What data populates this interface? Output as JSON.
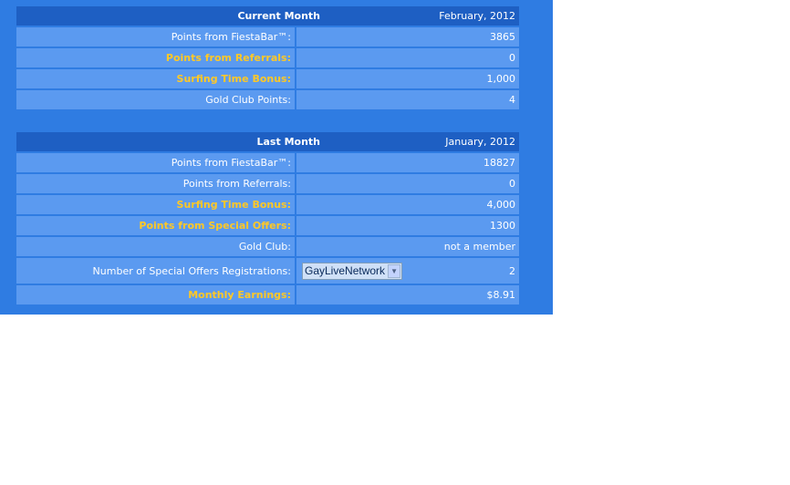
{
  "current_month": {
    "title": "Current Month",
    "date": "February, 2012",
    "rows": [
      {
        "label": "Points from FiestaBar™:",
        "value": "3865"
      },
      {
        "label": "Points from Referrals:",
        "value": "0"
      },
      {
        "label": "Surfing Time Bonus:",
        "value": "1,000"
      },
      {
        "label": "Gold Club Points:",
        "value": "4"
      }
    ]
  },
  "last_month": {
    "title": "Last Month",
    "date": "January, 2012",
    "rows": [
      {
        "label": "Points from FiestaBar™:",
        "value": "18827"
      },
      {
        "label": "Points from Referrals:",
        "value": "0"
      },
      {
        "label": "Surfing Time Bonus:",
        "value": "4,000"
      },
      {
        "label": "Points from Special Offers:",
        "value": "1300"
      },
      {
        "label": "Gold Club:",
        "value": "not a member"
      },
      {
        "label": "Number of Special Offers Registrations:",
        "value": "2",
        "select_value": "GayLiveNetwork"
      },
      {
        "label": "Monthly Earnings:",
        "value": "$8.91"
      }
    ]
  },
  "colors": {
    "panel_bg": "#2f7ce2",
    "header_bg": "#1e5fc3",
    "row_bg": "#5b9af0",
    "highlight_text": "#ffc826"
  },
  "icons": {
    "select_arrow": "chevron-down-icon"
  }
}
